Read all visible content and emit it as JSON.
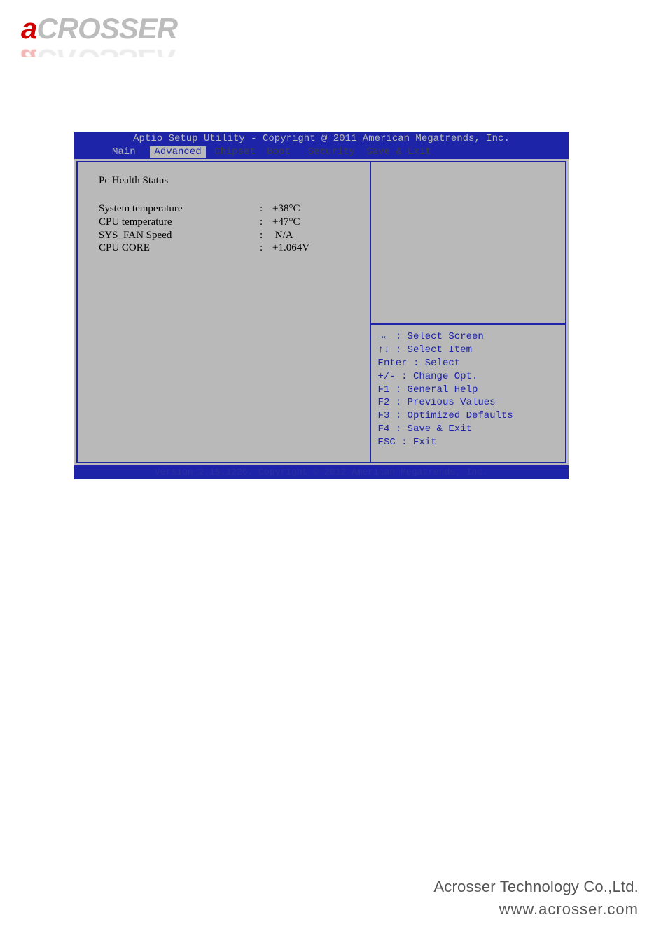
{
  "logo": {
    "first": "a",
    "rest": "CROSSER"
  },
  "bios": {
    "title": "Aptio Setup Utility - Copyright @ 2011 American Megatrends, Inc.",
    "menu": {
      "main": "Main",
      "advanced": "Advanced",
      "chipset": "Chipset",
      "boot": "Boot",
      "security": "Security",
      "save_exit": "Save & Exit"
    },
    "section_title": "Pc Health Status",
    "rows": [
      {
        "label": "System temperature",
        "value": "+38°C"
      },
      {
        "label": "CPU temperature",
        "value": "+47°C"
      },
      {
        "label": "SYS_FAN Speed",
        "value": "N/A"
      },
      {
        "label": "CPU CORE",
        "value": "+1.064V"
      }
    ],
    "help": {
      "l1": "→← : Select Screen",
      "l2": "↑↓ : Select Item",
      "l3": "Enter : Select",
      "l4": "+/- : Change Opt.",
      "l5": "F1 : General Help",
      "l6": "F2 : Previous Values",
      "l7": "F3 : Optimized Defaults",
      "l8": "F4 : Save & Exit",
      "l9": "ESC : Exit"
    },
    "footer": "Version 2.15.1226. Copyright © 2012 American Megatrends, Inc."
  },
  "page_footer": {
    "line1": "Acrosser Technology Co.,Ltd.",
    "line2": "www.acrosser.com"
  }
}
